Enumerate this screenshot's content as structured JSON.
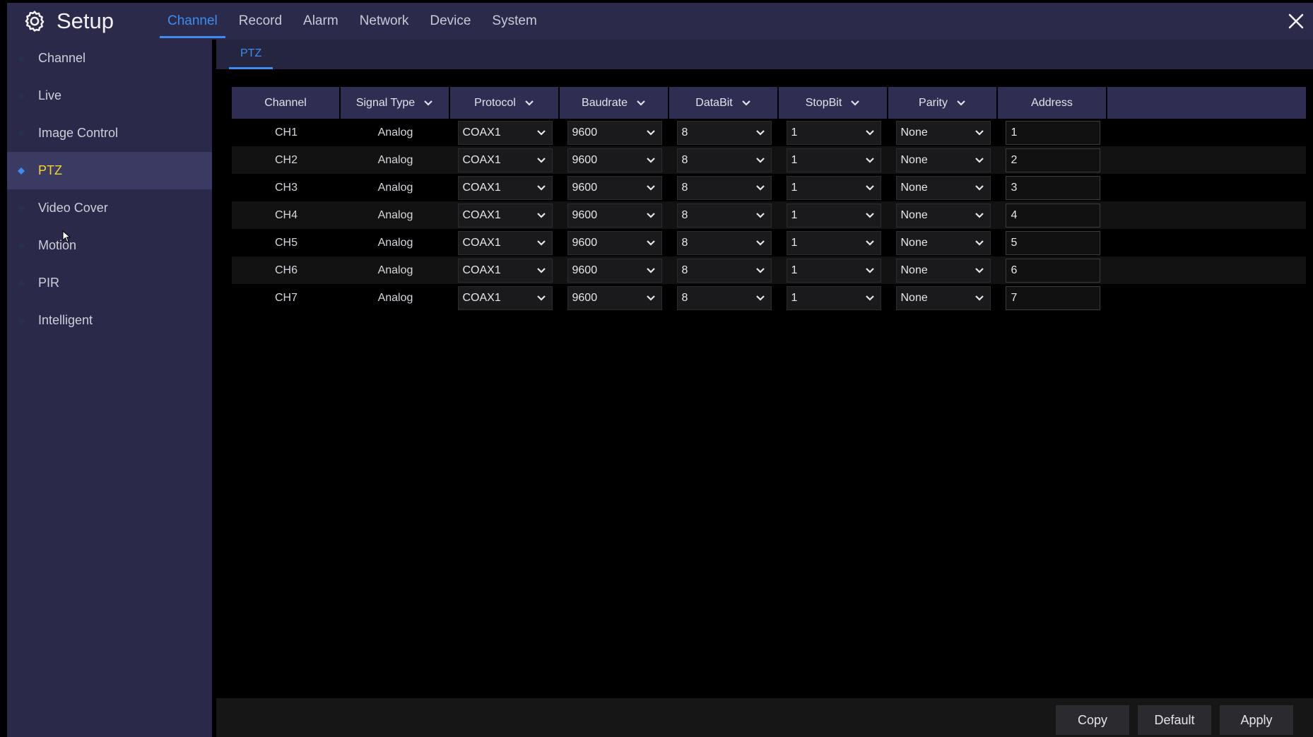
{
  "header": {
    "title": "Setup",
    "tabs": [
      {
        "label": "Channel",
        "active": true
      },
      {
        "label": "Record"
      },
      {
        "label": "Alarm"
      },
      {
        "label": "Network"
      },
      {
        "label": "Device"
      },
      {
        "label": "System"
      }
    ]
  },
  "sidebar": {
    "items": [
      {
        "label": "Channel"
      },
      {
        "label": "Live"
      },
      {
        "label": "Image Control"
      },
      {
        "label": "PTZ",
        "active": true
      },
      {
        "label": "Video Cover"
      },
      {
        "label": "Motion"
      },
      {
        "label": "PIR"
      },
      {
        "label": "Intelligent"
      }
    ]
  },
  "subtab": {
    "label": "PTZ"
  },
  "table": {
    "columns": [
      "Channel",
      "Signal Type",
      "Protocol",
      "Baudrate",
      "DataBit",
      "StopBit",
      "Parity",
      "Address"
    ],
    "rows": [
      {
        "channel": "CH1",
        "signal": "Analog",
        "protocol": "COAX1",
        "baudrate": "9600",
        "databit": "8",
        "stopbit": "1",
        "parity": "None",
        "address": "1"
      },
      {
        "channel": "CH2",
        "signal": "Analog",
        "protocol": "COAX1",
        "baudrate": "9600",
        "databit": "8",
        "stopbit": "1",
        "parity": "None",
        "address": "2"
      },
      {
        "channel": "CH3",
        "signal": "Analog",
        "protocol": "COAX1",
        "baudrate": "9600",
        "databit": "8",
        "stopbit": "1",
        "parity": "None",
        "address": "3"
      },
      {
        "channel": "CH4",
        "signal": "Analog",
        "protocol": "COAX1",
        "baudrate": "9600",
        "databit": "8",
        "stopbit": "1",
        "parity": "None",
        "address": "4"
      },
      {
        "channel": "CH5",
        "signal": "Analog",
        "protocol": "COAX1",
        "baudrate": "9600",
        "databit": "8",
        "stopbit": "1",
        "parity": "None",
        "address": "5"
      },
      {
        "channel": "CH6",
        "signal": "Analog",
        "protocol": "COAX1",
        "baudrate": "9600",
        "databit": "8",
        "stopbit": "1",
        "parity": "None",
        "address": "6"
      },
      {
        "channel": "CH7",
        "signal": "Analog",
        "protocol": "COAX1",
        "baudrate": "9600",
        "databit": "8",
        "stopbit": "1",
        "parity": "None",
        "address": "7"
      }
    ]
  },
  "footer": {
    "copy": "Copy",
    "default": "Default",
    "apply": "Apply"
  },
  "colors": {
    "accent": "#3d8df0",
    "active_sidebar_text": "#f4d62c",
    "panel": "#2a294a"
  }
}
